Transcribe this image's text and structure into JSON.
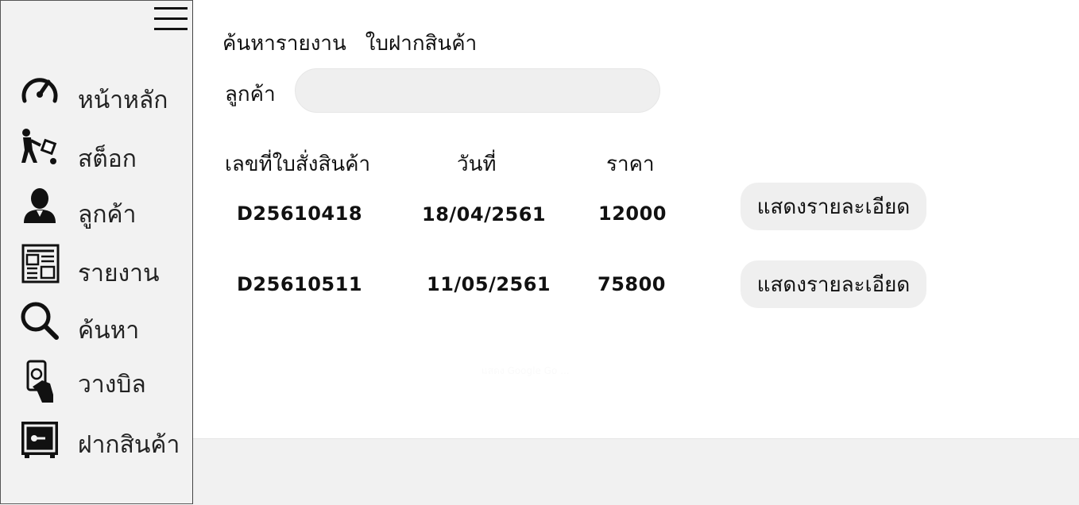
{
  "sidebar": {
    "menu_icon": "hamburger-menu-icon",
    "items": [
      {
        "label": "หน้าหลัก",
        "icon": "speedometer-icon"
      },
      {
        "label": "สต็อก",
        "icon": "hand-truck-icon"
      },
      {
        "label": "ลูกค้า",
        "icon": "user-icon"
      },
      {
        "label": "รายงาน",
        "icon": "newspaper-icon"
      },
      {
        "label": "ค้นหา",
        "icon": "magnifier-icon"
      },
      {
        "label": "วางบิล",
        "icon": "bill-in-hand-icon"
      },
      {
        "label": "ฝากสินค้า",
        "icon": "safe-icon"
      }
    ]
  },
  "header": {
    "title": "ค้นหารายงาน",
    "subtitle": "ใบฝากสินค้า"
  },
  "search": {
    "label": "ลูกค้า",
    "value": "",
    "placeholder": ""
  },
  "table": {
    "columns": [
      "เลขที่ใบสั่งสินค้า",
      "วันที่",
      "ราคา"
    ],
    "rows": [
      {
        "order_no": "D25610418",
        "date": "18/04/2561",
        "price": "12000",
        "action": "แสดงรายละเอียด"
      },
      {
        "order_no": "D25610511",
        "date": "11/05/2561",
        "price": "75800",
        "action": "แสดงรายละเอียด"
      }
    ]
  },
  "ghost_text": "แสดง Google Go ...",
  "colors": {
    "sidebar_bg": "#f2f2f2",
    "input_bg": "#efefef",
    "button_bg": "#efefef",
    "text": "#111111"
  }
}
